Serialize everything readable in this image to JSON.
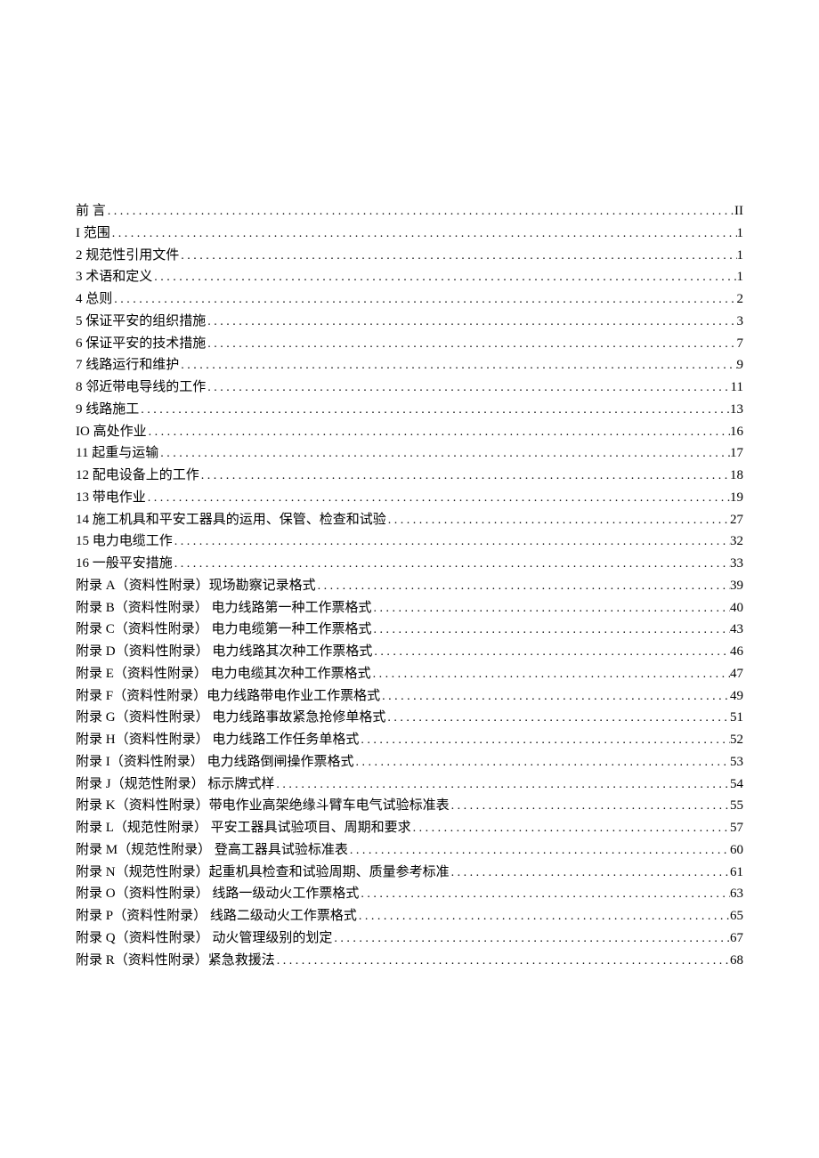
{
  "toc": [
    {
      "label": "前 言",
      "page": "II"
    },
    {
      "label": "I 范围",
      "page": "1"
    },
    {
      "label": "2 规范性引用文件",
      "page": "1"
    },
    {
      "label": "3 术语和定义",
      "page": "1"
    },
    {
      "label": "4 总则",
      "page": "2"
    },
    {
      "label": "5 保证平安的组织措施",
      "page": "3"
    },
    {
      "label": "6 保证平安的技术措施",
      "page": "7"
    },
    {
      "label": "7 线路运行和维护",
      "page": "9"
    },
    {
      "label": "8 邻近带电导线的工作",
      "page": "11"
    },
    {
      "label": "9 线路施工",
      "page": "13"
    },
    {
      "label": "IO 高处作业",
      "page": "16"
    },
    {
      "label": "11 起重与运输",
      "page": "17"
    },
    {
      "label": "12 配电设备上的工作",
      "page": "18"
    },
    {
      "label": "13 带电作业",
      "page": "19"
    },
    {
      "label": "14 施工机具和平安工器具的运用、保管、检查和试验",
      "page": "27"
    },
    {
      "label": "15    电力电缆工作",
      "page": "32"
    },
    {
      "label": "16    一般平安措施",
      "page": "33"
    },
    {
      "label": "附录 A（资料性附录）现场勘察记录格式",
      "page": "39"
    },
    {
      "label": "附录 B（资料性附录）      电力线路第一种工作票格式",
      "page": "40"
    },
    {
      "label": "附录 C（资料性附录）      电力电缆第一种工作票格式",
      "page": "43"
    },
    {
      "label": "附录 D（资料性附录）      电力线路其次种工作票格式",
      "page": "46"
    },
    {
      "label": "附录 E（资料性附录）      电力电缆其次种工作票格式",
      "page": "47"
    },
    {
      "label": "附录 F（资料性附录）电力线路带电作业工作票格式",
      "page": "49"
    },
    {
      "label": "附录 G（资料性附录）     电力线路事故紧急抢修单格式",
      "page": "51"
    },
    {
      "label": "附录 H（资料性附录）       电力线路工作任务单格式",
      "page": "52"
    },
    {
      "label": "附录 I（资料性附录）         电力线路倒闸操作票格式",
      "page": "53"
    },
    {
      "label": "附录 J（规范性附录）               标示牌式样",
      "page": "54"
    },
    {
      "label": "附录 K（资料性附录）带电作业高架绝缘斗臂车电气试验标准表",
      "page": "55"
    },
    {
      "label": "附录 L（规范性附录）  平安工器具试验项目、周期和要求",
      "page": "57"
    },
    {
      "label": "附录 M（规范性附录）         登高工器具试验标准表",
      "page": "60"
    },
    {
      "label": "附录 N（规范性附录）起重机具检查和试验周期、质量参考标准",
      "page": "61"
    },
    {
      "label": "附录 O（资料性附录）      线路一级动火工作票格式",
      "page": "63"
    },
    {
      "label": "附录 P（资料性附录）      线路二级动火工作票格式",
      "page": "65"
    },
    {
      "label": "附录 Q（资料性附录）        动火管理级别的划定",
      "page": "67"
    },
    {
      "label": "附录 R（资料性附录）紧急救援法",
      "page": "68"
    }
  ]
}
